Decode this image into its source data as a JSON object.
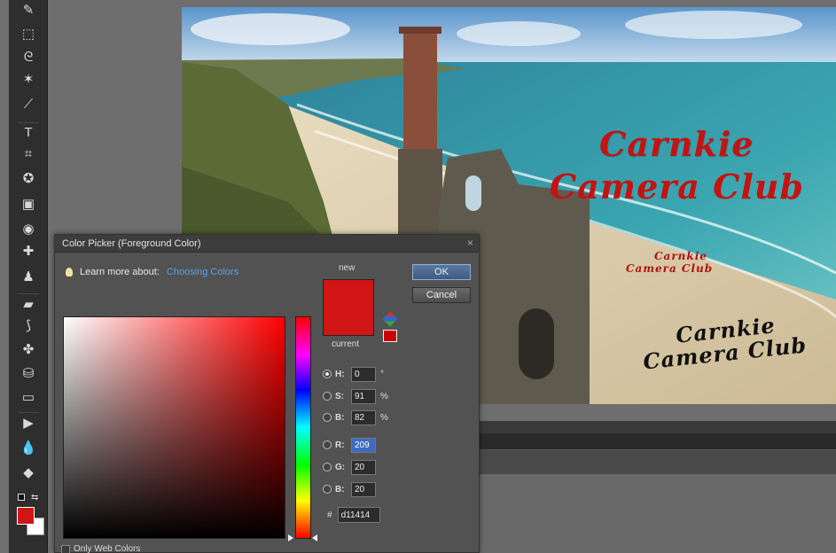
{
  "toolbox": {
    "tools": [
      {
        "name": "pencil-tool-icon",
        "glyph": "✎"
      },
      {
        "name": "marquee-tool-icon",
        "glyph": "⬚"
      },
      {
        "name": "lasso-tool-icon",
        "glyph": "ᘓ"
      },
      {
        "name": "magic-wand-tool-icon",
        "glyph": "✶"
      },
      {
        "name": "quick-selection-tool-icon",
        "glyph": "⟋"
      },
      {
        "name": "type-tool-icon",
        "glyph": "T"
      },
      {
        "name": "crop-tool-icon",
        "glyph": "⌗"
      },
      {
        "name": "cookie-cutter-tool-icon",
        "glyph": "✪"
      },
      {
        "name": "recompose-tool-icon",
        "glyph": "▣"
      },
      {
        "name": "red-eye-tool-icon",
        "glyph": "◉"
      },
      {
        "name": "spot-healing-tool-icon",
        "glyph": "✚"
      },
      {
        "name": "clone-stamp-tool-icon",
        "glyph": "♟"
      },
      {
        "name": "eraser-tool-icon",
        "glyph": "▰"
      },
      {
        "name": "brush-tool-icon",
        "glyph": "⟆"
      },
      {
        "name": "smart-brush-tool-icon",
        "glyph": "✤"
      },
      {
        "name": "paint-bucket-tool-icon",
        "glyph": "⛁"
      },
      {
        "name": "gradient-tool-icon",
        "glyph": "▭"
      },
      {
        "name": "shape-tool-icon",
        "glyph": "▶"
      },
      {
        "name": "blur-tool-icon",
        "glyph": "💧"
      },
      {
        "name": "sponge-tool-icon",
        "glyph": "◆"
      }
    ],
    "foreground_color": "#d11414",
    "background_color": "#ffffff"
  },
  "photo": {
    "title_large_line1": "Carnkie",
    "title_large_line2": "Camera Club",
    "title_small_line1": "Carnkie",
    "title_small_line2": "Camera Club",
    "title_dark_line1": "Carnkie",
    "title_dark_line2": "Camera Club"
  },
  "dialog": {
    "title": "Color Picker (Foreground Color)",
    "close_glyph": "×",
    "learn_more_prefix": "Learn more about:",
    "learn_more_link": "Choosing Colors",
    "new_label": "new",
    "current_label": "current",
    "ok_label": "OK",
    "cancel_label": "Cancel",
    "fields": {
      "h": {
        "label": "H:",
        "value": "0",
        "unit": "°"
      },
      "s": {
        "label": "S:",
        "value": "91",
        "unit": "%"
      },
      "b": {
        "label": "B:",
        "value": "82",
        "unit": "%"
      },
      "r": {
        "label": "R:",
        "value": "209"
      },
      "g": {
        "label": "G:",
        "value": "20"
      },
      "bb": {
        "label": "B:",
        "value": "20"
      }
    },
    "hex_label": "#",
    "hex_value": "d11414",
    "only_web_colors": "Only Web Colors",
    "new_color": "#d11414",
    "websafe_color": "#cc0000"
  }
}
